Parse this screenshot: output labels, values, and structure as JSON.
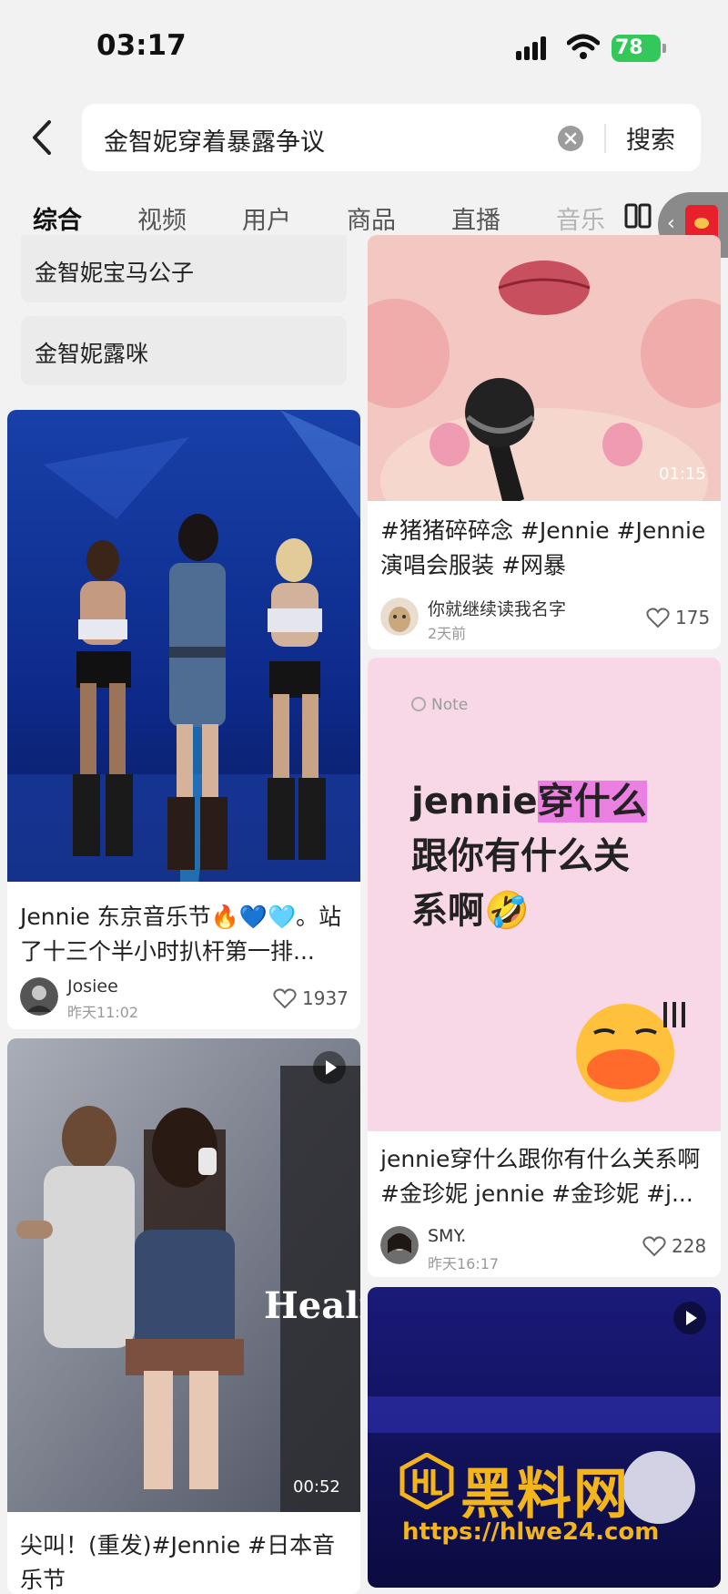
{
  "status_bar": {
    "time": "03:17",
    "battery": "78"
  },
  "search": {
    "query": "金智妮穿着暴露争议",
    "search_button": "搜索"
  },
  "tabs": [
    "综合",
    "视频",
    "用户",
    "商品",
    "直播",
    "音乐"
  ],
  "suggestions": [
    "金智妮宝马公子",
    "金智妮露咪"
  ],
  "cards": [
    {
      "title": "Jennie 东京音乐节🔥💙🩵。站了十三个半小时扒杆第一排...",
      "author": "Josiee",
      "time": "昨天11:02",
      "likes": "1937"
    },
    {
      "title": "尖叫！(重发)#Jennie #日本音乐节",
      "duration": "00:52",
      "overlay_text": "Heali"
    },
    {
      "title": "#猪猪碎碎念 #Jennie #Jennie 演唱会服装 #网暴",
      "duration": "01:15",
      "author": "你就继续读我名字",
      "time": "2天前",
      "likes": "175"
    },
    {
      "note_label": "Note",
      "note_lines": [
        "jennie穿什么",
        "跟你有什么关",
        "系啊🤣"
      ],
      "note_highlight": "穿什么",
      "note_prefix": "jennie",
      "title": "jennie穿什么跟你有什么关系啊#金珍妮 jennie #金珍妮 #j...",
      "author": "SMY.",
      "time": "昨天16:17",
      "likes": "228"
    }
  ],
  "watermark": {
    "title": "黑料网",
    "url": "https://hlwe24.com"
  }
}
